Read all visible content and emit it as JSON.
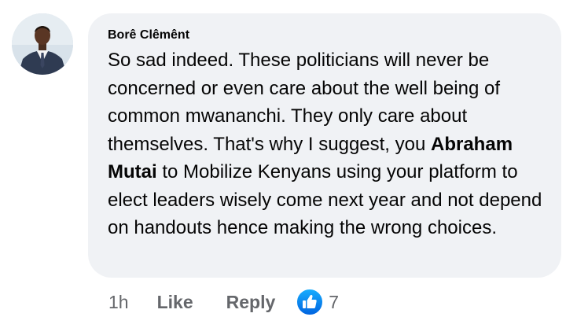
{
  "comment": {
    "author": "Borê Clêmênt",
    "text_part1": "So sad indeed. These politicians will never be concerned or even care about the well being of common mwananchi. They only care about themselves. That's why I suggest, you ",
    "mention": "Abraham Mutai",
    "text_part2": " to Mobilize Kenyans using your platform to elect leaders wisely come next year and not depend on handouts hence making the wrong choices."
  },
  "actions": {
    "time": "1h",
    "like_label": "Like",
    "reply_label": "Reply",
    "reaction_icon": "like-thumbs-up-icon",
    "reaction_count": "7"
  },
  "colors": {
    "bubble": "#f0f2f5",
    "text": "#050505",
    "muted": "#65676b",
    "like_blue": "#1877f2"
  }
}
